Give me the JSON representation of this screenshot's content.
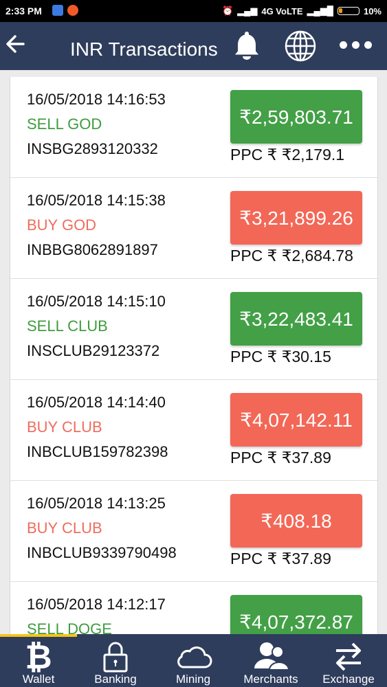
{
  "status_bar": {
    "time": "2:33 PM",
    "network": "4G VoLTE",
    "battery": "10%"
  },
  "header": {
    "title": "INR Transactions"
  },
  "transactions": [
    {
      "datetime": "16/05/2018 14:16:53",
      "type": "SELL GOD",
      "kind": "sell",
      "txid": "INSBG2893120332",
      "amount": "₹2,59,803.71",
      "ppc": "PPC ₹ ₹2,179.1"
    },
    {
      "datetime": "16/05/2018 14:15:38",
      "type": "BUY GOD",
      "kind": "buy",
      "txid": "INBBG8062891897",
      "amount": "₹3,21,899.26",
      "ppc": "PPC ₹ ₹2,684.78"
    },
    {
      "datetime": "16/05/2018 14:15:10",
      "type": "SELL CLUB",
      "kind": "sell",
      "txid": "INSCLUB29123372",
      "amount": "₹3,22,483.41",
      "ppc": "PPC ₹ ₹30.15"
    },
    {
      "datetime": "16/05/2018 14:14:40",
      "type": "BUY CLUB",
      "kind": "buy",
      "txid": "INBCLUB159782398",
      "amount": "₹4,07,142.11",
      "ppc": "PPC ₹ ₹37.89"
    },
    {
      "datetime": "16/05/2018 14:13:25",
      "type": "BUY CLUB",
      "kind": "buy",
      "txid": "INBCLUB9339790498",
      "amount": "₹408.18",
      "ppc": "PPC ₹ ₹37.89"
    },
    {
      "datetime": "16/05/2018 14:12:17",
      "type": "SELL DOGE",
      "kind": "sell",
      "txid": "",
      "amount": "₹4,07,372.87",
      "ppc": ""
    }
  ],
  "bottom_nav": {
    "items": [
      {
        "label": "Wallet",
        "icon": "bitcoin-icon"
      },
      {
        "label": "Banking",
        "icon": "lock-icon"
      },
      {
        "label": "Mining",
        "icon": "cloud-icon"
      },
      {
        "label": "Merchants",
        "icon": "users-icon"
      },
      {
        "label": "Exchange",
        "icon": "swap-icon"
      }
    ],
    "active": "Wallet"
  },
  "colors": {
    "header_bg": "#2f3d5c",
    "sell": "#43a047",
    "buy": "#f36757",
    "active_indicator": "#f5c518"
  }
}
